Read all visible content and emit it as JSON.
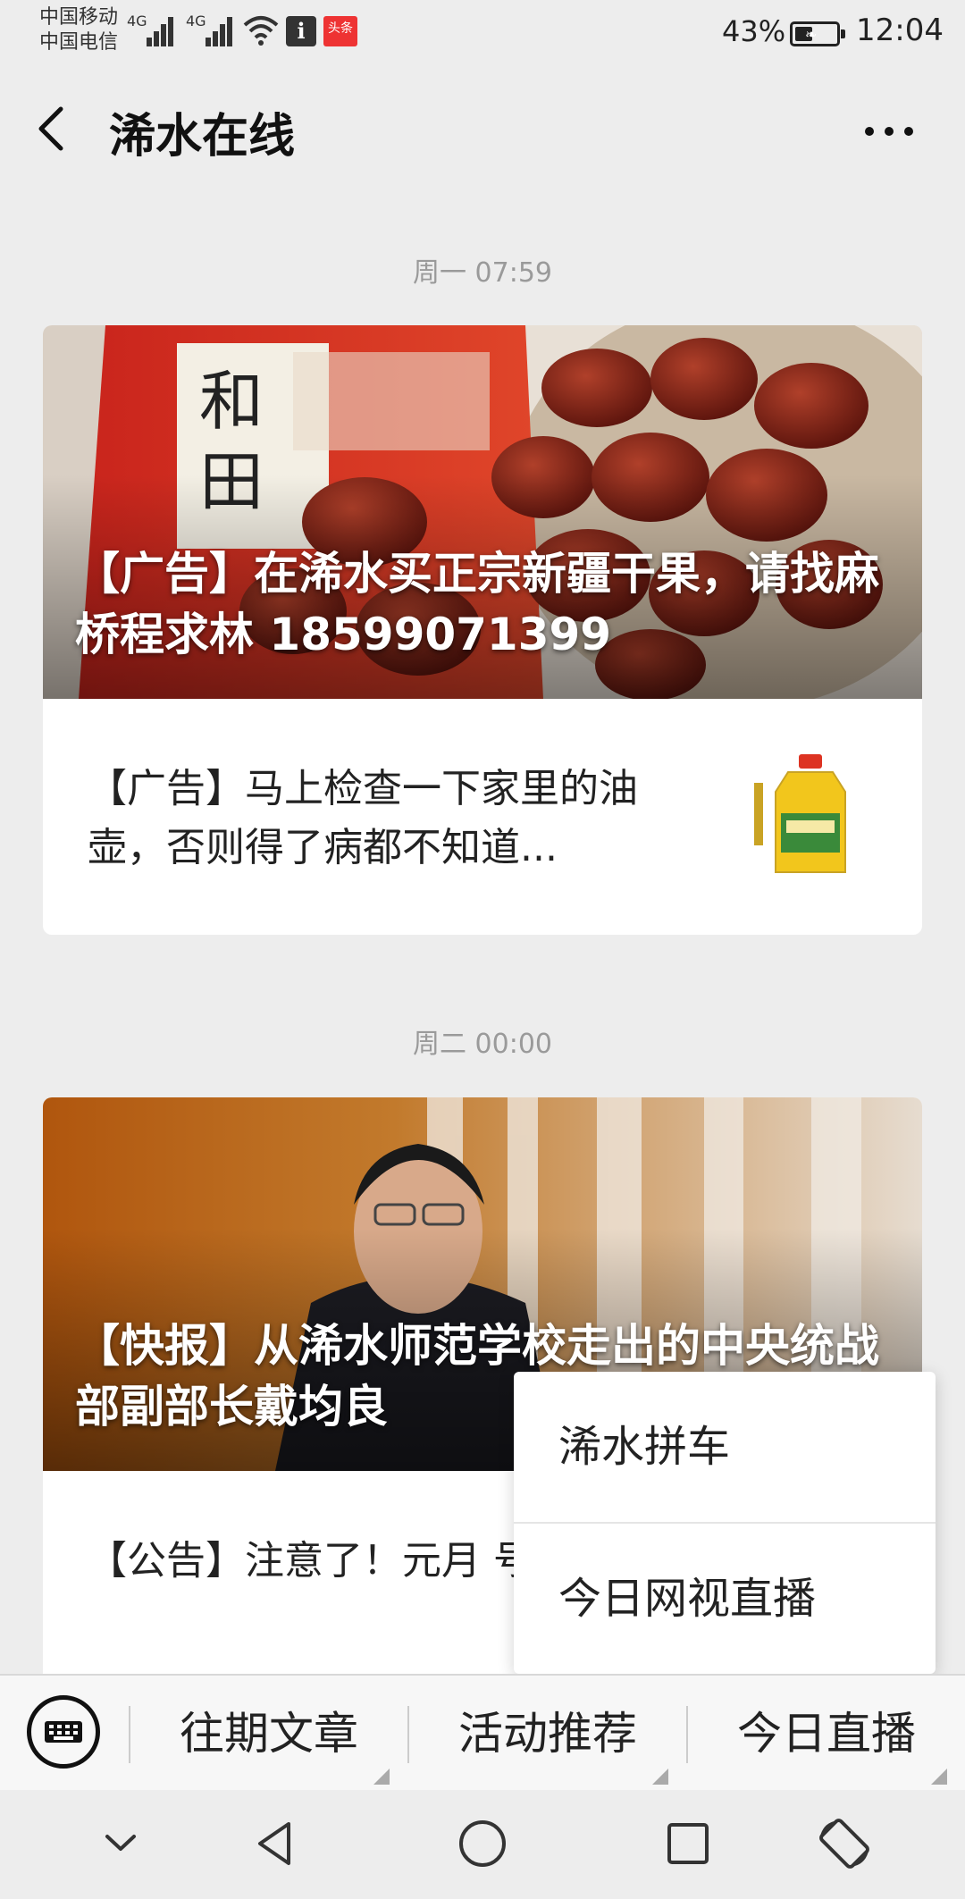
{
  "status_bar": {
    "carrier_1": "中国移动",
    "carrier_2": "中国电信",
    "network_1": "4G",
    "network_2": "4G",
    "toutiao_label": "头条",
    "battery_percent": "43%",
    "battery_level": 0.43,
    "time": "12:04",
    "icons": [
      "signal-icon",
      "wifi-icon",
      "info-icon",
      "toutiao-icon",
      "battery-icon"
    ]
  },
  "nav": {
    "title": "浠水在线",
    "back_icon": "chevron-left-icon",
    "more_icon": "more-dots-icon"
  },
  "feed": [
    {
      "timestamp": "周一 07:59",
      "hero_title": "【广告】在浠水买正宗新疆干果，请找麻桥程求林 18599071399",
      "sub_title": "【广告】马上检查一下家里的油壶，否则得了病都不知道..."
    },
    {
      "timestamp": "周二 00:00",
      "hero_title": "【快报】从浠水师范学校走出的中央统战部副部长戴均良",
      "sub_title": "【公告】注意了！元月 号浠水这些地方要停电"
    }
  ],
  "popup_menu": {
    "items": [
      "浠水拼车",
      "今日网视直播"
    ]
  },
  "menu_bar": {
    "keyboard_icon": "keyboard-icon",
    "items": [
      "往期文章",
      "活动推荐",
      "今日直播"
    ]
  },
  "system_nav": {
    "icons": [
      "collapse-icon",
      "back-triangle-icon",
      "home-circle-icon",
      "recents-square-icon",
      "rotate-icon"
    ]
  },
  "colors": {
    "background": "#ededed",
    "card": "#ffffff",
    "timestamp": "#9a9a9a",
    "text": "#222222"
  }
}
